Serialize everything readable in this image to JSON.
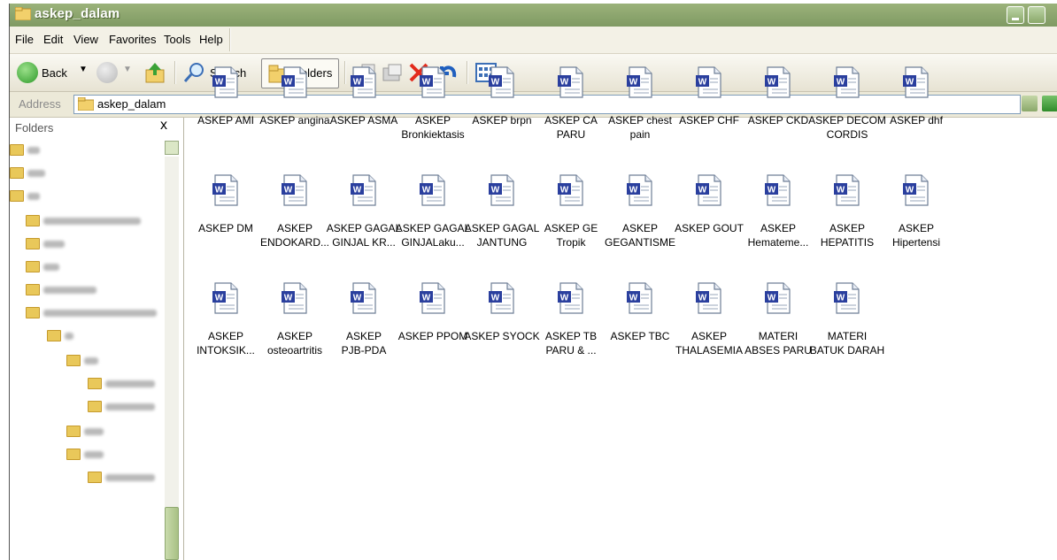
{
  "window": {
    "title": "askep_dalam"
  },
  "menu": [
    "File",
    "Edit",
    "View",
    "Favorites",
    "Tools",
    "Help"
  ],
  "toolbar": {
    "back_label": "Back",
    "search_label": "Search",
    "folders_label": "Folders"
  },
  "address": {
    "label": "Address",
    "value": "askep_dalam"
  },
  "folders_pane": {
    "header": "Folders",
    "close": "x"
  },
  "files": [
    "ASKEP AMI",
    "ASKEP angina",
    "ASKEP ASMA",
    "ASKEP\nBronkiektasis",
    "ASKEP brpn",
    "ASKEP CA\nPARU",
    "ASKEP chest\npain",
    "ASKEP CHF",
    "ASKEP CKD",
    "ASKEP DECOM\nCORDIS",
    "ASKEP dhf",
    "ASKEP DM",
    "ASKEP\nENDOKARD...",
    "ASKEP GAGAL\nGINJAL KR...",
    "ASKEP GAGAL\nGINJALaku...",
    "ASKEP GAGAL\nJANTUNG",
    "ASKEP GE\nTropik",
    "ASKEP\nGEGANTISME",
    "ASKEP GOUT",
    "ASKEP\nHemateme...",
    "ASKEP\nHEPATITIS",
    "ASKEP\nHipertensi",
    "ASKEP\nINTOKSIK...",
    "ASKEP\nosteoartritis",
    "ASKEP\nPJB-PDA",
    "ASKEP PPOM",
    "ASKEP SYOCK",
    "ASKEP TB\nPARU & ...",
    "ASKEP TBC",
    "ASKEP\nTHALASEMIA",
    "MATERI\nABSES PARU",
    "MATERI\nBATUK DARAH"
  ],
  "colors": {
    "titlebar": "#8ea66f",
    "chrome": "#ece9d8",
    "folder": "#e9c85a",
    "word_blue": "#2a3f9e"
  }
}
